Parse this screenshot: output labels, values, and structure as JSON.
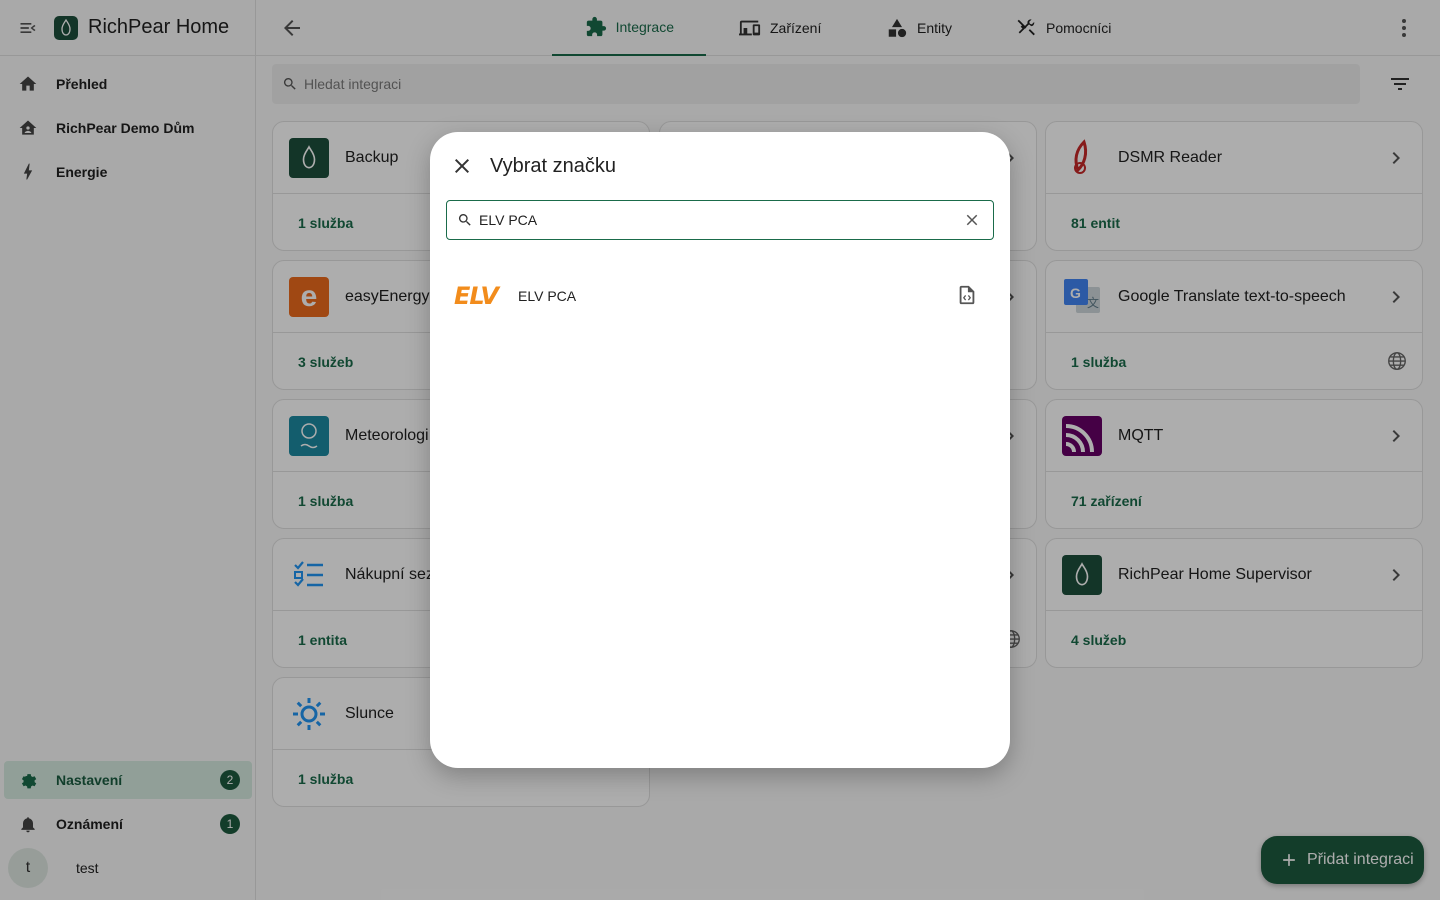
{
  "sidebar": {
    "title": "RichPear Home",
    "items": [
      {
        "label": "Přehled",
        "icon": "home-icon"
      },
      {
        "label": "RichPear Demo Dům",
        "icon": "home-account-icon"
      },
      {
        "label": "Energie",
        "icon": "lightning-icon"
      }
    ],
    "settings": {
      "label": "Nastavení",
      "badge": "2",
      "icon": "gear-icon"
    },
    "notifications": {
      "label": "Oznámení",
      "badge": "1",
      "icon": "bell-icon"
    },
    "user": {
      "initial": "t",
      "name": "test"
    }
  },
  "tabs": [
    {
      "label": "Integrace",
      "icon": "puzzle-icon",
      "active": true
    },
    {
      "label": "Zařízení",
      "icon": "devices-icon"
    },
    {
      "label": "Entity",
      "icon": "shapes-icon"
    },
    {
      "label": "Pomocníci",
      "icon": "tools-icon"
    }
  ],
  "search": {
    "placeholder": "Hledat integraci"
  },
  "cards": [
    {
      "name": "Backup",
      "footer": "1 služba"
    },
    {
      "name": "DSMR Reader",
      "footer": "81 entit"
    },
    {
      "name": "easyEnergy",
      "footer": "3 služeb"
    },
    {
      "name": "Google Translate text-to-speech",
      "footer": "1 služba"
    },
    {
      "name": "Meteorologi",
      "footer": "1 služba"
    },
    {
      "name": "MQTT",
      "footer": "71 zařízení"
    },
    {
      "name": "Nákupní sez",
      "footer": "1 entita"
    },
    {
      "name": "RichPear Home Supervisor",
      "footer": "4 služeb"
    },
    {
      "name": "Slunce",
      "footer": "1 služba"
    }
  ],
  "fab": {
    "label": "Přidat integraci"
  },
  "dialog": {
    "title": "Vybrat značku",
    "search_value": "ELV PCA",
    "results": [
      {
        "logo_text": "ELV",
        "name": "ELV PCA",
        "icon": "file-code-icon"
      }
    ]
  },
  "colors": {
    "accent": "#1a6b4a",
    "primary_dark": "#1d5a3f",
    "elv_orange": "#f28c1c"
  }
}
